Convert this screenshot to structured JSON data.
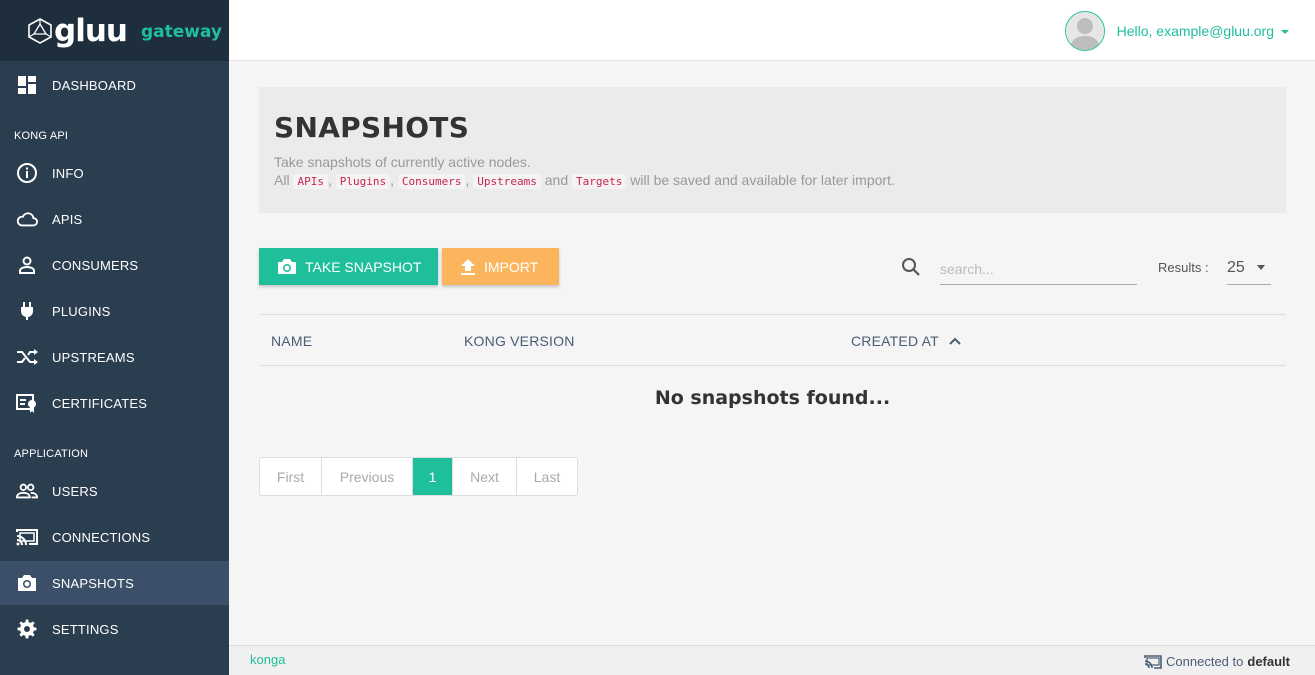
{
  "brand": {
    "name": "gluu",
    "sub": "gateway"
  },
  "sidebar": {
    "items": [
      {
        "label": "DASHBOARD",
        "icon": "dashboard-icon"
      },
      {
        "label": "INFO",
        "icon": "info-icon"
      },
      {
        "label": "APIS",
        "icon": "cloud-icon"
      },
      {
        "label": "CONSUMERS",
        "icon": "person-icon"
      },
      {
        "label": "PLUGINS",
        "icon": "plug-icon"
      },
      {
        "label": "UPSTREAMS",
        "icon": "shuffle-icon"
      },
      {
        "label": "CERTIFICATES",
        "icon": "certificate-icon"
      },
      {
        "label": "USERS",
        "icon": "users-icon"
      },
      {
        "label": "CONNECTIONS",
        "icon": "cast-icon"
      },
      {
        "label": "SNAPSHOTS",
        "icon": "camera-icon",
        "active": true
      },
      {
        "label": "SETTINGS",
        "icon": "gear-icon"
      }
    ],
    "sections": {
      "kong": "KONG API",
      "application": "APPLICATION"
    }
  },
  "header": {
    "greeting": "Hello, example@gluu.org"
  },
  "page": {
    "title": "SNAPSHOTS",
    "desc_line1": "Take snapshots of currently active nodes.",
    "desc_all": "All",
    "desc_tags": [
      "APIs",
      "Plugins",
      "Consumers",
      "Upstreams",
      "Targets"
    ],
    "desc_and": "and",
    "desc_tail": "will be saved and available for later import."
  },
  "toolbar": {
    "take_label": "TAKE SNAPSHOT",
    "import_label": "IMPORT",
    "search_placeholder": "search...",
    "results_label": "Results :",
    "results_value": "25"
  },
  "table": {
    "columns": [
      "NAME",
      "KONG VERSION",
      "CREATED AT"
    ],
    "empty": "No snapshots found..."
  },
  "pagination": {
    "first": "First",
    "previous": "Previous",
    "current": "1",
    "next": "Next",
    "last": "Last"
  },
  "footer": {
    "left": "konga",
    "connected_label": "Connected to",
    "connection": "default"
  },
  "colors": {
    "accent": "#1fbf9c",
    "sidebar": "#2b3e50",
    "import": "#fbb55d"
  }
}
